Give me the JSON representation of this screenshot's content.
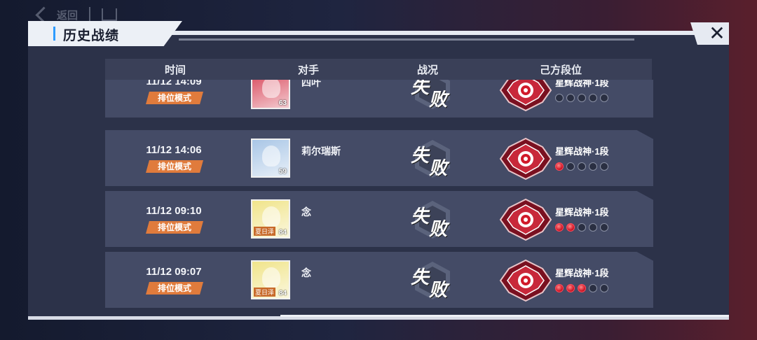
{
  "nav": {
    "back_label": "返回"
  },
  "panel": {
    "title": "历史战绩"
  },
  "table": {
    "headers": {
      "time": "时间",
      "opponent": "对手",
      "result": "战况",
      "rank": "己方段位"
    }
  },
  "rows": [
    {
      "time": "11/12 14:09",
      "mode": "排位模式",
      "opponent": "四叶",
      "level": "63",
      "tag": "",
      "result_a": "失",
      "result_b": "败",
      "rank": "星辉战神·1段",
      "stars_filled": 0,
      "stars_total": 5,
      "avatar_color": "#d8475a"
    },
    {
      "time": "11/12 14:06",
      "mode": "排位模式",
      "opponent": "莉尔瑞斯",
      "level": "59",
      "tag": "",
      "result_a": "失",
      "result_b": "败",
      "rank": "星辉战神·1段",
      "stars_filled": 1,
      "stars_total": 5,
      "avatar_color": "#a9c6e6"
    },
    {
      "time": "11/12 09:10",
      "mode": "排位模式",
      "opponent": "念",
      "level": "84",
      "tag": "夏日泽",
      "result_a": "失",
      "result_b": "败",
      "rank": "星辉战神·1段",
      "stars_filled": 2,
      "stars_total": 5,
      "avatar_color": "#f0e48a"
    },
    {
      "time": "11/12 09:07",
      "mode": "排位模式",
      "opponent": "念",
      "level": "84",
      "tag": "夏日泽",
      "result_a": "失",
      "result_b": "败",
      "rank": "星辉战神·1段",
      "stars_filled": 3,
      "stars_total": 5,
      "avatar_color": "#f0e48a"
    }
  ]
}
